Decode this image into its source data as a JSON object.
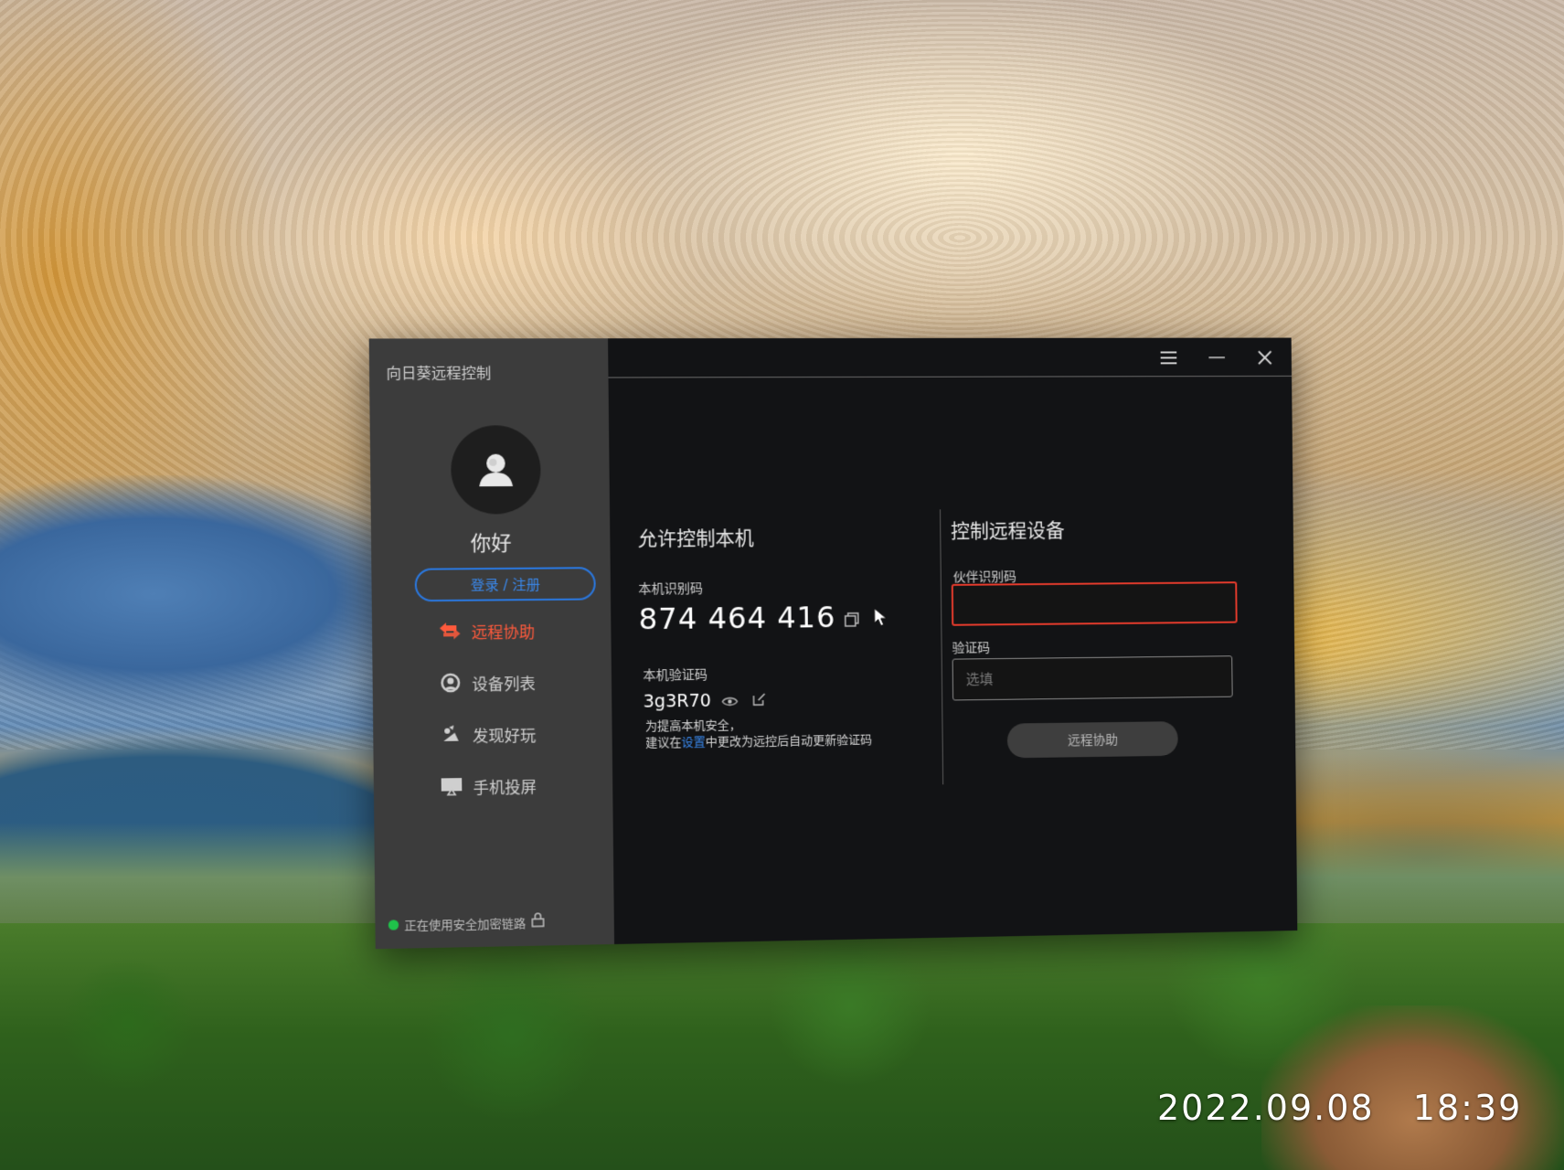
{
  "window": {
    "title": "向日葵远程控制"
  },
  "sidebar": {
    "greeting": "你好",
    "login_label": "登录 / 注册",
    "items": [
      {
        "label": "远程协助",
        "icon": "remote-assist-icon",
        "active": true
      },
      {
        "label": "设备列表",
        "icon": "device-list-icon",
        "active": false
      },
      {
        "label": "发现好玩",
        "icon": "discover-icon",
        "active": false
      },
      {
        "label": "手机投屏",
        "icon": "screen-cast-icon",
        "active": false
      }
    ],
    "secure_status": "正在使用安全加密链路"
  },
  "allow": {
    "title": "允许控制本机",
    "id_label": "本机识别码",
    "id_value": "874 464 416",
    "code_label": "本机验证码",
    "code_value": "3g3R70",
    "hint_line1": "为提高本机安全，",
    "hint_line2_prefix": "建议在",
    "hint_link": "设置",
    "hint_line2_suffix": "中更改为远控后自动更新验证码"
  },
  "control": {
    "title": "控制远程设备",
    "partner_label": "伙伴识别码",
    "partner_value": "",
    "verify_label": "验证码",
    "verify_placeholder": "选填",
    "button_label": "远程协助"
  },
  "colors": {
    "accent_red": "#ff5a3c",
    "link_blue": "#3a8af0",
    "secure_green": "#1fc24a"
  },
  "photo_timestamp": "2022.09.08   18:39"
}
